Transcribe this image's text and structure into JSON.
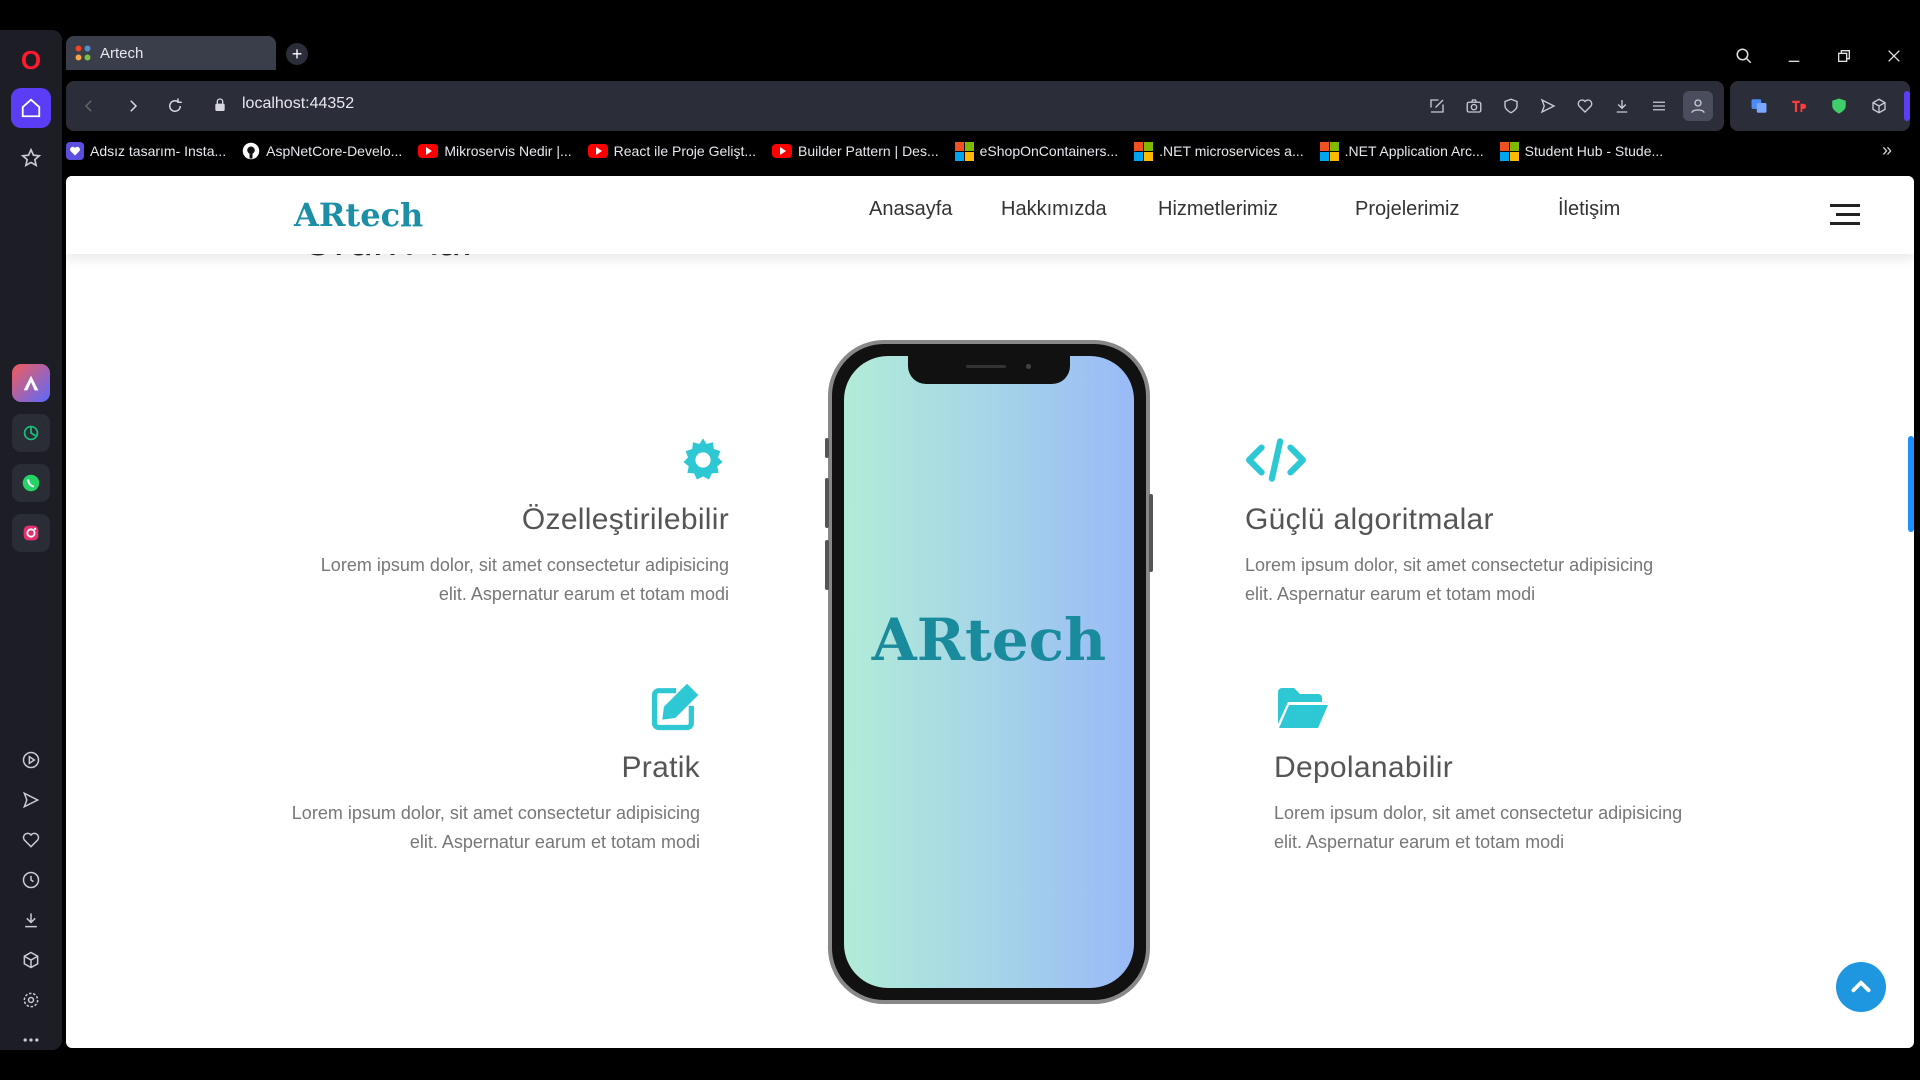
{
  "browser": {
    "tab_title": "Artech",
    "url": "localhost:44352",
    "opera_logo": "O",
    "bookmarks": [
      {
        "label": "Adsız tasarım- Insta...",
        "icon": "heart-icon"
      },
      {
        "label": "AspNetCore-Develo...",
        "icon": "github-icon"
      },
      {
        "label": "Mikroservis Nedir |...",
        "icon": "youtube-icon"
      },
      {
        "label": "React ile Proje Gelişt...",
        "icon": "youtube-icon"
      },
      {
        "label": "Builder Pattern | Des...",
        "icon": "youtube-icon"
      },
      {
        "label": "eShopOnContainers...",
        "icon": "microsoft-icon"
      },
      {
        "label": ".NET microservices a...",
        "icon": "microsoft-icon"
      },
      {
        "label": ".NET Application Arc...",
        "icon": "microsoft-icon"
      },
      {
        "label": "Student Hub - Stude...",
        "icon": "microsoft-icon"
      }
    ]
  },
  "site": {
    "brand": "ARtech",
    "nav": [
      "Anasayfa",
      "Hakkımızda",
      "Hizmetlerimiz",
      "Projelerimiz",
      "İletişim"
    ],
    "partial_heading": "Ürün Adı",
    "phone_logo": "ARtech",
    "features": [
      {
        "title": "Özelleştirilebilir",
        "desc": "Lorem ipsum dolor, sit amet consectetur adipisicing elit. Aspernatur earum et totam modi",
        "icon": "gear-icon"
      },
      {
        "title": "Pratik",
        "desc": "Lorem ipsum dolor, sit amet consectetur adipisicing elit. Aspernatur earum et totam modi",
        "icon": "edit-icon"
      },
      {
        "title": "Güçlü algoritmalar",
        "desc": "Lorem ipsum dolor, sit amet consectetur adipisicing elit. Aspernatur earum et totam modi",
        "icon": "code-icon"
      },
      {
        "title": "Depolanabilir",
        "desc": "Lorem ipsum dolor, sit amet consectetur adipisicing elit. Aspernatur earum et totam modi",
        "icon": "folder-open-icon"
      }
    ]
  },
  "colors": {
    "accent": "#2ec8d4",
    "brand": "#1c8fa6",
    "opera_accent": "#5a3df5",
    "scroll_top": "#1e97e0"
  }
}
